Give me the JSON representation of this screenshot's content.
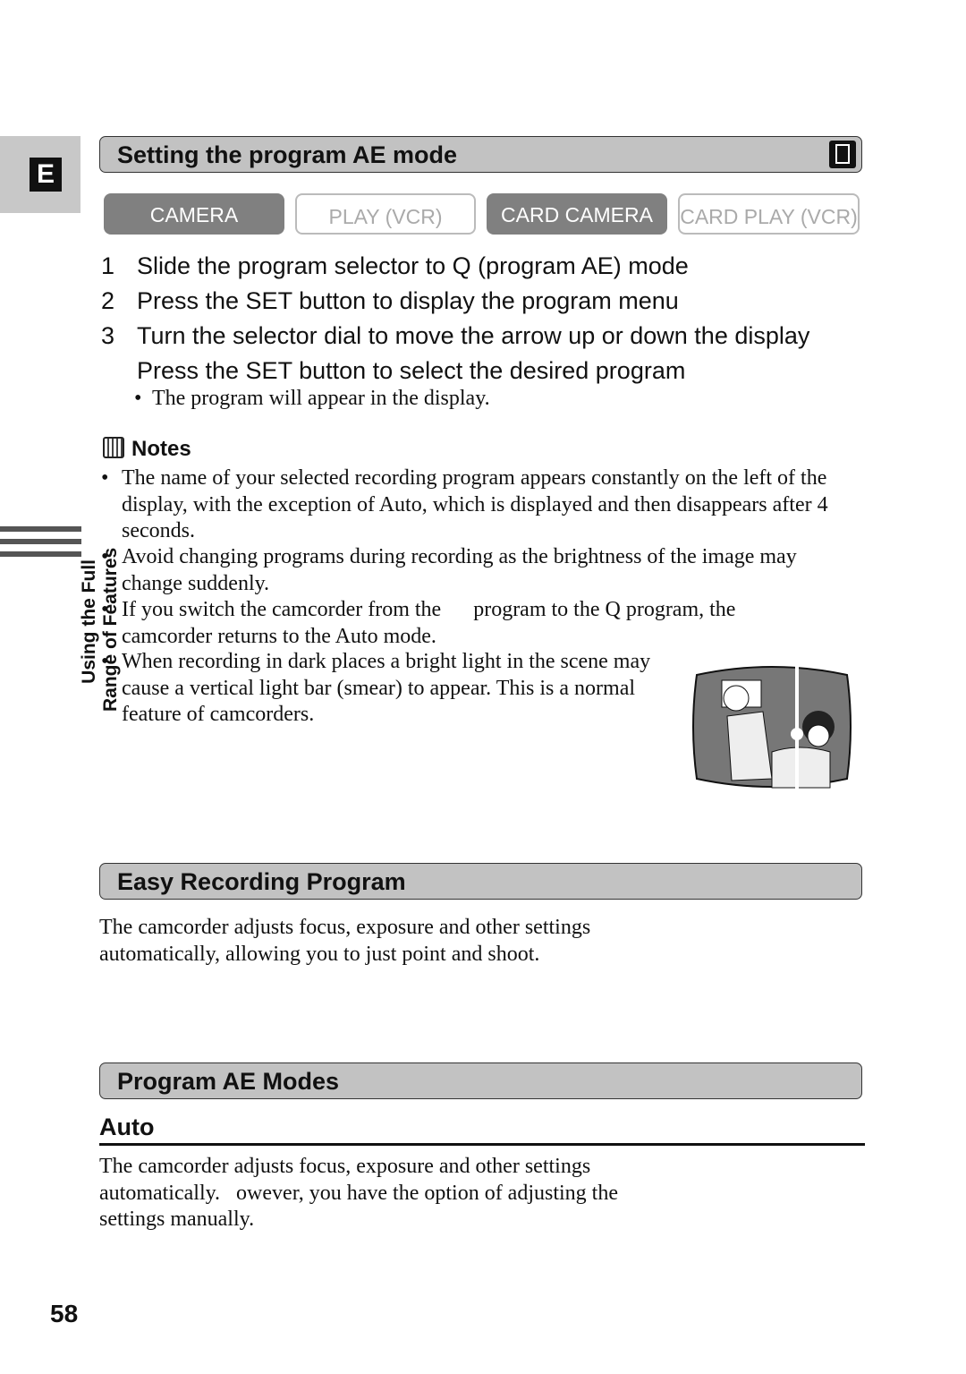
{
  "tab_letter": "E",
  "side_label": [
    "Using the Full",
    "Range of Features"
  ],
  "section1": {
    "title": "Setting the program AE mode",
    "icon": "camcorder-card-icon"
  },
  "mode_buttons": [
    {
      "label": "CAMERA",
      "active": true
    },
    {
      "label": "PLAY (VCR)",
      "active": false
    },
    {
      "label": "CARD CAMERA",
      "active": true
    },
    {
      "label": "CARD PLAY (VCR)",
      "active": false
    }
  ],
  "steps": [
    {
      "num": "1",
      "text": "Slide the program selector to Q (program AE) mode"
    },
    {
      "num": "2",
      "text": "Press the SET button to display the program menu"
    },
    {
      "num": "3",
      "text": "Turn the selector dial to move the arrow up or down the display"
    },
    {
      "num": "",
      "text": "Press the SET button to select the desired program"
    }
  ],
  "step_note": "The program will appear in the display.",
  "notes": {
    "title": "Notes",
    "icon": "notes-icon",
    "items": [
      "The name of your selected recording program appears constantly on the left of the display, with the exception of Auto, which is displayed and then disappears after 4 seconds.",
      "Avoid changing programs during recording as the brightness of the image may change suddenly.",
      "If you switch the camcorder from the      program to the Q program, the camcorder returns to the Auto mode.",
      "When recording in dark places a bright light in the scene may cause a vertical light bar (smear) to appear. This is a normal feature of camcorders."
    ]
  },
  "section2": {
    "title": "Easy Recording Program",
    "text": "The camcorder adjusts focus, exposure and other settings automatically, allowing you to just point and shoot."
  },
  "section3": {
    "title": "Program AE Modes",
    "subtitle": "Auto",
    "text": "The camcorder adjusts focus, exposure and other settings automatically.   owever, you have the option of adjusting the settings manually."
  },
  "page_number": "58"
}
